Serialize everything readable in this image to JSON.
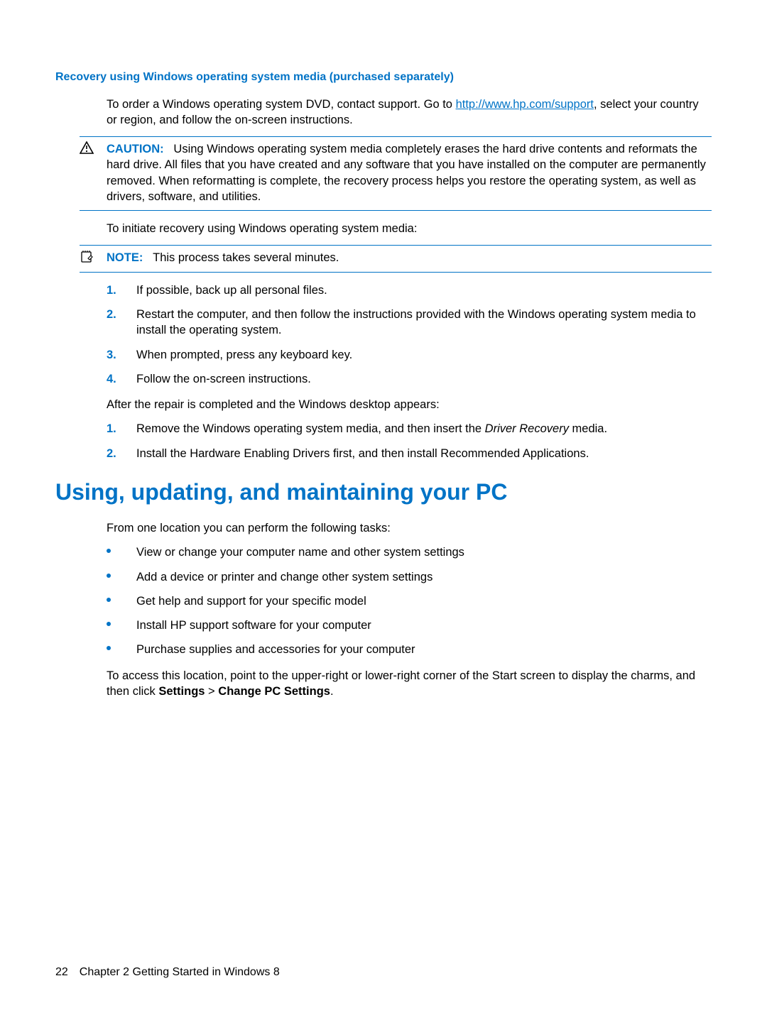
{
  "section1": {
    "heading": "Recovery using Windows operating system media (purchased separately)",
    "para1_a": "To order a Windows operating system DVD, contact support. Go to ",
    "para1_link": "http://www.hp.com/support",
    "para1_b": ", select your country or region, and follow the on-screen instructions.",
    "caution_label": "CAUTION:",
    "caution_text": "Using Windows operating system media completely erases the hard drive contents and reformats the hard drive. All files that you have created and any software that you have installed on the computer are permanently removed. When reformatting is complete, the recovery process helps you restore the operating system, as well as drivers, software, and utilities.",
    "para2": "To initiate recovery using Windows operating system media:",
    "note_label": "NOTE:",
    "note_text": "This process takes several minutes.",
    "list1": [
      "If possible, back up all personal files.",
      "Restart the computer, and then follow the instructions provided with the Windows operating system media to install the operating system.",
      "When prompted, press any keyboard key.",
      "Follow the on-screen instructions."
    ],
    "para3": "After the repair is completed and the Windows desktop appears:",
    "list2_item1_a": "Remove the Windows operating system media, and then insert the ",
    "list2_item1_italic": "Driver Recovery",
    "list2_item1_b": " media.",
    "list2_item2": "Install the Hardware Enabling Drivers first, and then install Recommended Applications."
  },
  "section2": {
    "heading": "Using, updating, and maintaining your PC",
    "para1": "From one location you can perform the following tasks:",
    "bullets": [
      "View or change your computer name and other system settings",
      "Add a device or printer and change other system settings",
      "Get help and support for your specific model",
      "Install HP support software for your computer",
      "Purchase supplies and accessories for your computer"
    ],
    "para2_a": "To access this location, point to the upper-right or lower-right corner of the Start screen to display the charms, and then click ",
    "para2_bold1": "Settings",
    "para2_mid": " > ",
    "para2_bold2": "Change PC Settings",
    "para2_end": "."
  },
  "footer": {
    "page": "22",
    "chapter": "Chapter 2   Getting Started in Windows 8"
  }
}
